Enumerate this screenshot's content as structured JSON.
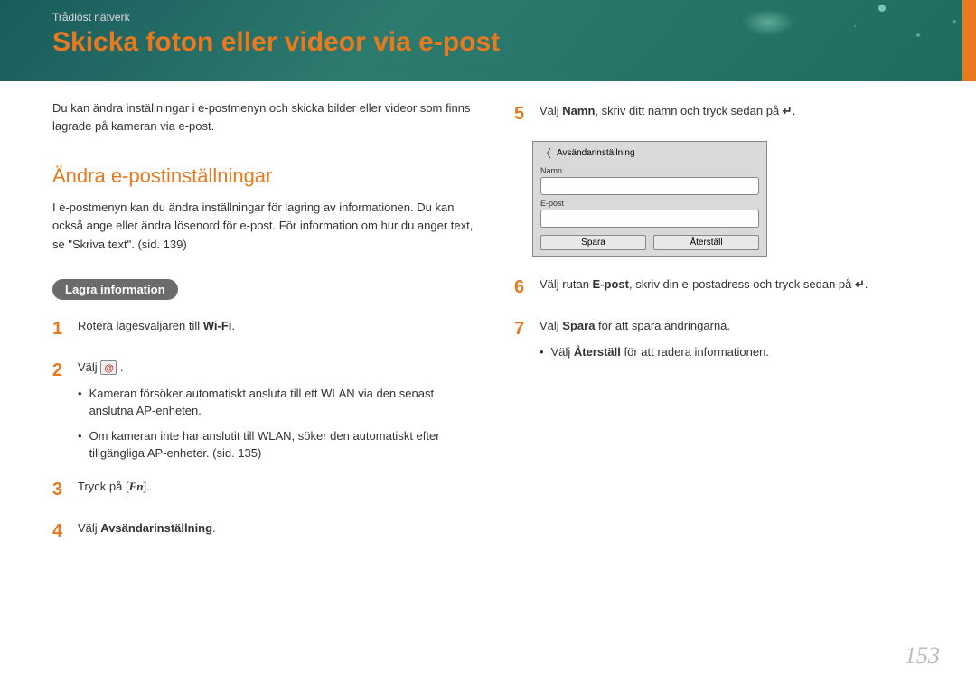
{
  "breadcrumb": "Trådlöst nätverk",
  "title": "Skicka foton eller videor via e-post",
  "intro": "Du kan ändra inställningar i e-postmenyn och skicka bilder eller videor som finns lagrade på kameran via e-post.",
  "subheading": "Ändra e-postinställningar",
  "section_desc": "I e-postmenyn kan du ändra inställningar för lagring av informationen. Du kan också ange eller ändra lösenord för e-post. För information om hur du anger text, se \"Skriva text\". (sid. 139)",
  "badge": "Lagra information",
  "steps_left": {
    "1": {
      "pre": "Rotera lägesväljaren till ",
      "icon": "Wi-Fi",
      "post": "."
    },
    "2": {
      "pre": "Välj ",
      "post": " .",
      "bullets": [
        "Kameran försöker automatiskt ansluta till ett WLAN via den senast anslutna AP-enheten.",
        "Om kameran inte har anslutit till WLAN, söker den automatiskt efter tillgängliga AP-enheter. (sid. 135)"
      ]
    },
    "3": {
      "pre": "Tryck på [",
      "fn": "Fn",
      "post": "]."
    },
    "4": {
      "pre": "Välj ",
      "bold": "Avsändarinställning",
      "post": "."
    }
  },
  "steps_right": {
    "5": {
      "pre": "Välj ",
      "bold": "Namn",
      "post1": ", skriv ditt namn och tryck sedan på ",
      "enter": "↵",
      "post2": "."
    },
    "6": {
      "pre": "Välj rutan ",
      "bold": "E-post",
      "post1": ", skriv din e-postadress och tryck sedan på ",
      "enter": "↵",
      "post2": "."
    },
    "7": {
      "pre": "Välj ",
      "bold": "Spara",
      "post": " för att spara ändringarna.",
      "bullet_pre": "Välj ",
      "bullet_bold": "Återställ",
      "bullet_post": " för att radera informationen."
    }
  },
  "device": {
    "header": "Avsändarinställning",
    "label1": "Namn",
    "label2": "E-post",
    "btn1": "Spara",
    "btn2": "Återställ"
  },
  "page_num": "153"
}
